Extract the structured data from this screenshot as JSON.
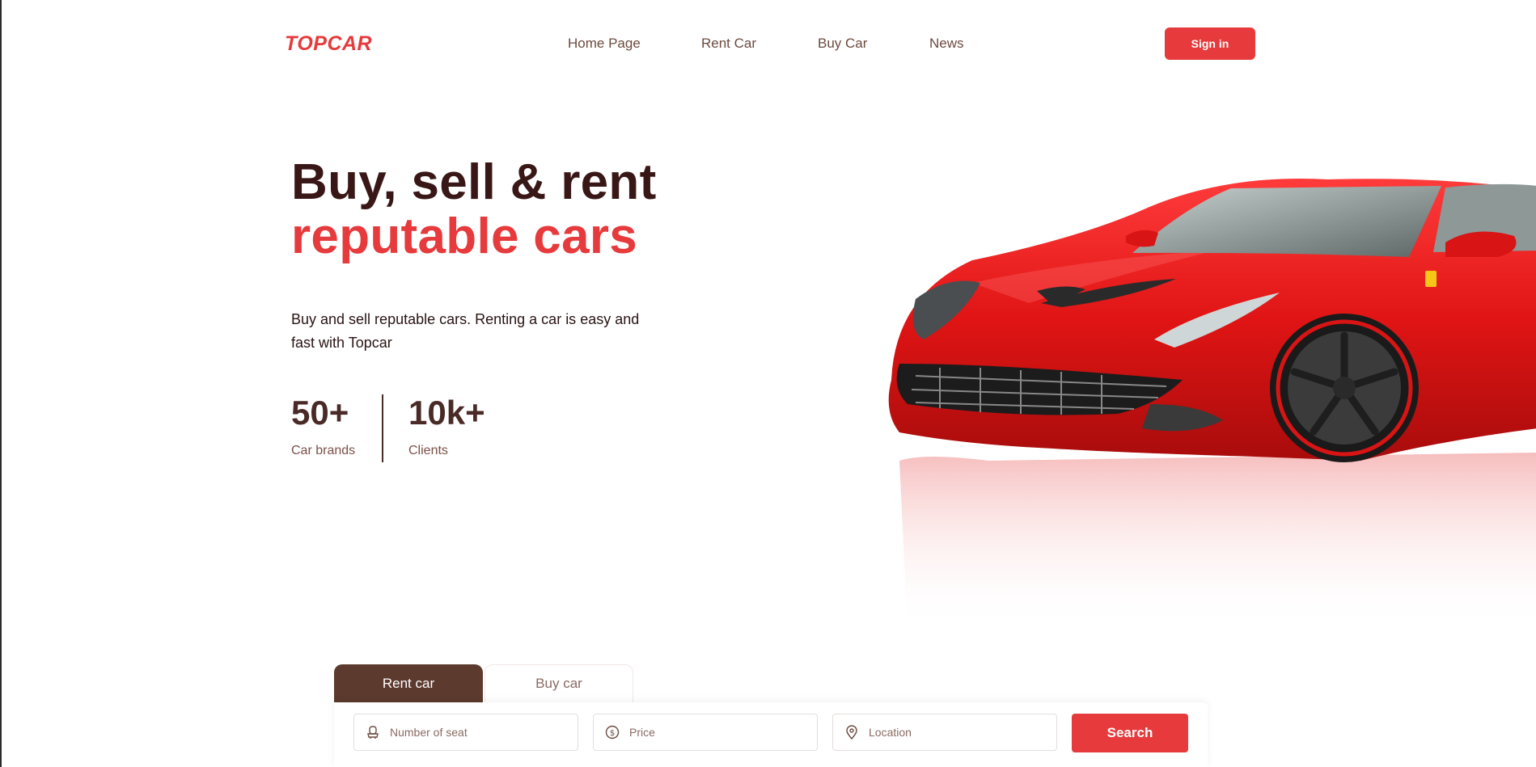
{
  "brand": {
    "logo_text": "TOPCAR",
    "accent_color": "#e63a3c",
    "dark_brown": "#5c3a2e"
  },
  "nav": {
    "links": [
      {
        "label": "Home Page"
      },
      {
        "label": "Rent Car"
      },
      {
        "label": "Buy Car"
      },
      {
        "label": "News"
      }
    ],
    "signin_label": "Sign in"
  },
  "hero": {
    "title_line1": "Buy, sell & rent",
    "title_line2": "reputable cars",
    "description": "Buy and sell reputable cars. Renting a car is easy and fast with Topcar",
    "image": "red-sports-car"
  },
  "stats": [
    {
      "value": "50+",
      "label": "Car brands"
    },
    {
      "value": "10k+",
      "label": "Clients"
    }
  ],
  "search": {
    "tabs": [
      {
        "label": "Rent car",
        "active": true
      },
      {
        "label": "Buy car",
        "active": false
      }
    ],
    "fields": [
      {
        "icon": "seat-icon",
        "placeholder": "Number of seat",
        "value": ""
      },
      {
        "icon": "dollar-icon",
        "placeholder": "Price",
        "value": ""
      },
      {
        "icon": "location-pin-icon",
        "placeholder": "Location",
        "value": ""
      }
    ],
    "button_label": "Search"
  }
}
